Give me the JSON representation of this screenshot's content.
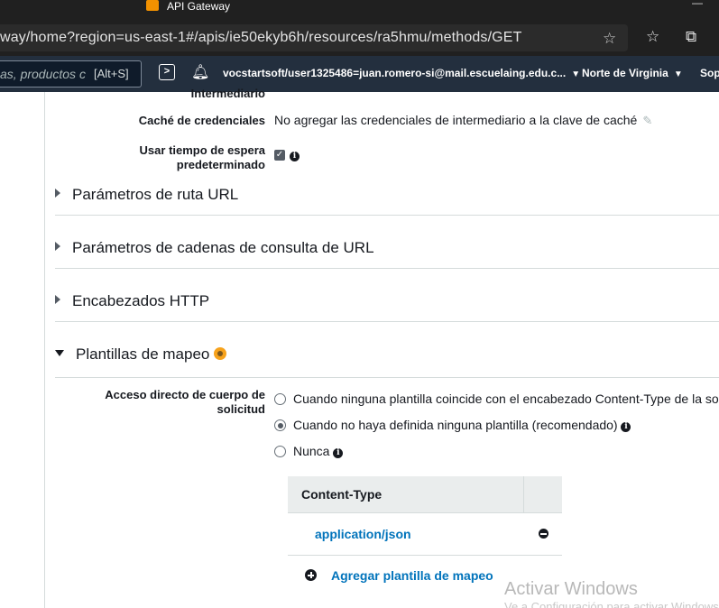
{
  "browser": {
    "tab_title": "API Gateway",
    "close_glyph": "—",
    "url": "way/home?region=us-east-1#/apis/ie50ekyb6h/resources/ra5hmu/methods/GET"
  },
  "aws_nav": {
    "search_placeholder": "as, productos c",
    "search_shortcut": "[Alt+S]",
    "account": "vocstartsoft/user1325486=juan.romero-si@mail.escuelaing.edu.c...",
    "region": "Norte de Virginia",
    "support": "Sop"
  },
  "integration": {
    "intermediary_label_partial": "Intermediario",
    "cache_label": "Caché de credenciales",
    "cache_value": "No agregar las credenciales de intermediario a la clave de caché",
    "timeout_label_line1": "Usar tiempo de espera",
    "timeout_label_line2": "predeterminado",
    "timeout_checked": true
  },
  "sections": {
    "url_path_params": "Parámetros de ruta URL",
    "url_query_params": "Parámetros de cadenas de consulta de URL",
    "http_headers": "Encabezados HTTP",
    "mapping_templates": "Plantillas de mapeo"
  },
  "passthrough": {
    "label_line1": "Acceso directo de cuerpo de",
    "label_line2": "solicitud",
    "options": [
      {
        "label": "Cuando ninguna plantilla coincide con el encabezado Content-Type de la so",
        "selected": false,
        "info": false
      },
      {
        "label": "Cuando no haya definida ninguna plantilla (recomendado)",
        "selected": true,
        "info": true
      },
      {
        "label": "Nunca",
        "selected": false,
        "info": true
      }
    ]
  },
  "content_types": {
    "header": "Content-Type",
    "rows": [
      "application/json"
    ],
    "add_label": "Agregar plantilla de mapeo"
  },
  "watermark": {
    "title": "Activar Windows",
    "subtitle": "Ve a Configuración para activar Windows"
  }
}
